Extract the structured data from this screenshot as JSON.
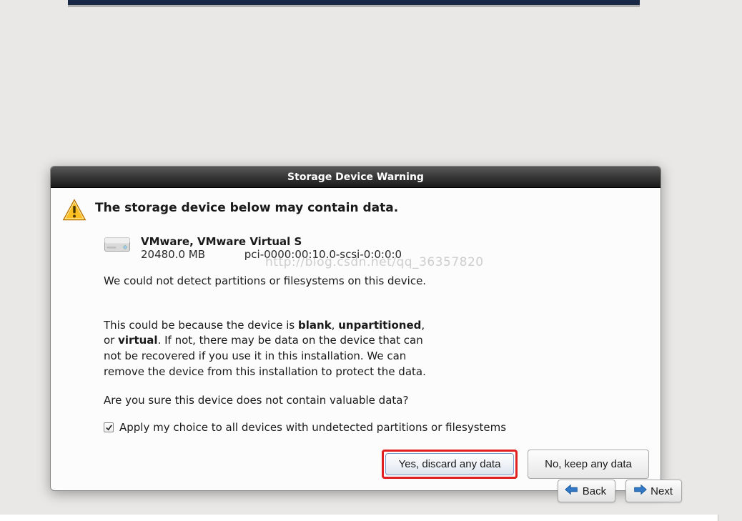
{
  "dialog": {
    "title": "Storage Device Warning",
    "heading": "The storage device below may contain data.",
    "device": {
      "name": "VMware, VMware Virtual S",
      "size": "20480.0 MB",
      "path": "pci-0000:00:10.0-scsi-0:0:0:0"
    },
    "message": {
      "line1": "We could not detect partitions or filesystems on this device.",
      "p2_pre": "This could be because the device is ",
      "p2_s1": "blank",
      "p2_mid1": ", ",
      "p2_s2": "unpartitioned",
      "p2_mid2": ",\nor ",
      "p2_s3": "virtual",
      "p2_post": ". If not, there may be data on the device that can\nnot be recovered if you use it in this installation. We can\nremove the device from this installation to protect the data.",
      "line3": "Are you sure this device does not contain valuable data?"
    },
    "checkbox_label": "Apply my choice to all devices with undetected partitions or filesystems",
    "buttons": {
      "discard": "Yes, discard any data",
      "keep": "No, keep any data"
    }
  },
  "footer": {
    "back": "Back",
    "next": "Next"
  },
  "watermark": "http://blog.csdn.net/qq_36357820"
}
